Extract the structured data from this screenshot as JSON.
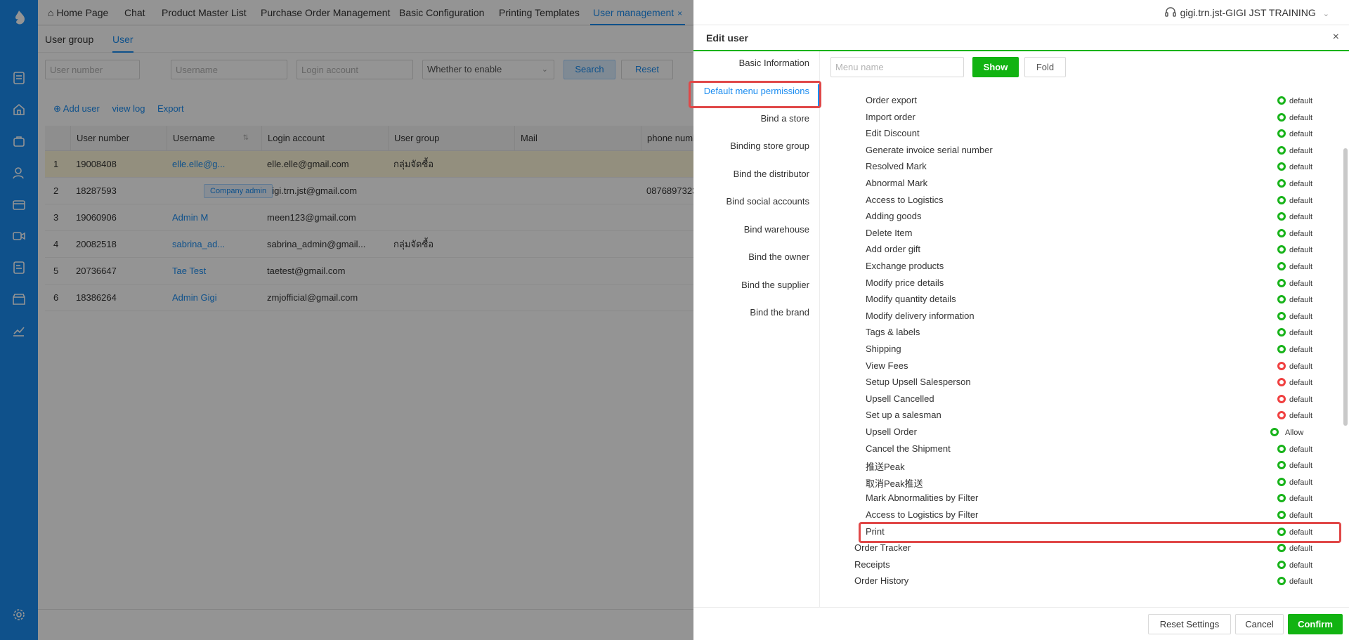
{
  "sidebar": {
    "icons": [
      "logo-icon",
      "document-icon",
      "home-icon",
      "bag-icon",
      "user-icon",
      "wallet-icon",
      "video-icon",
      "edit-list-icon",
      "store-icon",
      "chart-icon",
      "settings-icon"
    ]
  },
  "topbar": {
    "tabs": [
      {
        "label": "Home Page"
      },
      {
        "label": "Chat"
      },
      {
        "label": "Product Master List"
      },
      {
        "label": "Purchase Order Management"
      },
      {
        "label": "Basic Configuration"
      },
      {
        "label": "Printing Templates"
      },
      {
        "label": "User management"
      }
    ],
    "close_mark": "×",
    "account": "gigi.trn.jst-GIGI JST TRAINING",
    "chevron": "⌄"
  },
  "subtabs": [
    "User group",
    "User"
  ],
  "filters": {
    "user_number_placeholder": "User number",
    "username_placeholder": "Username",
    "login_account_placeholder": "Login account",
    "enable_select": "Whether to enable",
    "search": "Search",
    "reset": "Reset"
  },
  "actions": {
    "add_user": "⊕ Add user",
    "view_log": "view log",
    "export": "Export"
  },
  "table": {
    "columns": [
      "User number",
      "Username",
      "Login account",
      "User group",
      "Mail",
      "phone numb"
    ],
    "rows": [
      {
        "idx": "1",
        "number": "19008408",
        "username": "elle.elle@g...",
        "login": "elle.elle@gmail.com",
        "group": "กลุ่มจัดซื้อ",
        "mail": "",
        "phone": ""
      },
      {
        "idx": "2",
        "number": "18287593",
        "username": "",
        "badge": "Company admin",
        "login": "gigi.trn.jst@gmail.com",
        "group": "",
        "mail": "",
        "phone": "0876897323"
      },
      {
        "idx": "3",
        "number": "19060906",
        "username": "Admin M",
        "login": "meen123@gmail.com",
        "group": "",
        "mail": "",
        "phone": ""
      },
      {
        "idx": "4",
        "number": "20082518",
        "username": "sabrina_ad...",
        "login": "sabrina_admin@gmail...",
        "group": "กลุ่มจัดซื้อ",
        "mail": "",
        "phone": ""
      },
      {
        "idx": "5",
        "number": "20736647",
        "username": "Tae Test",
        "login": "taetest@gmail.com",
        "group": "",
        "mail": "",
        "phone": ""
      },
      {
        "idx": "6",
        "number": "18386264",
        "username": "Admin Gigi",
        "login": "zmjofficial@gmail.com",
        "group": "",
        "mail": "",
        "phone": ""
      }
    ]
  },
  "drawer": {
    "title": "Edit user",
    "close": "×",
    "nav": [
      "Basic Information",
      "Default menu permissions",
      "Bind a store",
      "Binding store group",
      "Bind the distributor",
      "Bind social accounts",
      "Bind warehouse",
      "Bind the owner",
      "Bind the supplier",
      "Bind the brand"
    ],
    "menu_placeholder": "Menu name",
    "show": "Show",
    "fold": "Fold",
    "permissions": [
      {
        "label": "Order export",
        "status": "default",
        "color": "green",
        "indent": 1
      },
      {
        "label": "Import order",
        "status": "default",
        "color": "green",
        "indent": 1
      },
      {
        "label": "Edit Discount",
        "status": "default",
        "color": "green",
        "indent": 1
      },
      {
        "label": "Generate invoice serial number",
        "status": "default",
        "color": "green",
        "indent": 1
      },
      {
        "label": "Resolved Mark",
        "status": "default",
        "color": "green",
        "indent": 1
      },
      {
        "label": "Abnormal Mark",
        "status": "default",
        "color": "green",
        "indent": 1
      },
      {
        "label": "Access to Logistics",
        "status": "default",
        "color": "green",
        "indent": 1
      },
      {
        "label": "Adding goods",
        "status": "default",
        "color": "green",
        "indent": 1
      },
      {
        "label": "Delete Item",
        "status": "default",
        "color": "green",
        "indent": 1
      },
      {
        "label": "Add order gift",
        "status": "default",
        "color": "green",
        "indent": 1
      },
      {
        "label": "Exchange products",
        "status": "default",
        "color": "green",
        "indent": 1
      },
      {
        "label": "Modify price details",
        "status": "default",
        "color": "green",
        "indent": 1
      },
      {
        "label": "Modify quantity details",
        "status": "default",
        "color": "green",
        "indent": 1
      },
      {
        "label": "Modify delivery information",
        "status": "default",
        "color": "green",
        "indent": 1
      },
      {
        "label": "Tags & labels",
        "status": "default",
        "color": "green",
        "indent": 1
      },
      {
        "label": "Shipping",
        "status": "default",
        "color": "green",
        "indent": 1
      },
      {
        "label": "View Fees",
        "status": "default",
        "color": "red",
        "indent": 1
      },
      {
        "label": "Setup Upsell Salesperson",
        "status": "default",
        "color": "red",
        "indent": 1
      },
      {
        "label": "Upsell Cancelled",
        "status": "default",
        "color": "red",
        "indent": 1
      },
      {
        "label": "Set up a salesman",
        "status": "default",
        "color": "red",
        "indent": 1
      },
      {
        "label": "Upsell Order",
        "status": "Allow",
        "color": "green",
        "indent": 1
      },
      {
        "label": "Cancel the Shipment",
        "status": "default",
        "color": "green",
        "indent": 1
      },
      {
        "label": "推送Peak",
        "status": "default",
        "color": "green",
        "indent": 1
      },
      {
        "label": "取消Peak推送",
        "status": "default",
        "color": "green",
        "indent": 1
      },
      {
        "label": "Mark Abnormalities by Filter",
        "status": "default",
        "color": "green",
        "indent": 1
      },
      {
        "label": "Access to Logistics by Filter",
        "status": "default",
        "color": "green",
        "indent": 1
      },
      {
        "label": "Print",
        "status": "default",
        "color": "green",
        "indent": 1
      },
      {
        "label": "Order Tracker",
        "status": "default",
        "color": "green",
        "indent": 0
      },
      {
        "label": "Receipts",
        "status": "default",
        "color": "green",
        "indent": 0
      },
      {
        "label": "Order History",
        "status": "default",
        "color": "green",
        "indent": 0
      }
    ],
    "footer": {
      "reset": "Reset Settings",
      "cancel": "Cancel",
      "confirm": "Confirm"
    }
  },
  "colors": {
    "brand_blue": "#1a8cf0",
    "green": "#12b312",
    "red": "#f04040",
    "highlight": "#e04848"
  }
}
